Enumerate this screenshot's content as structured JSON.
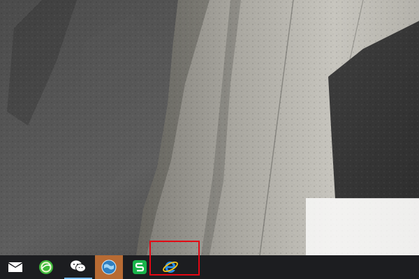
{
  "desktop": {
    "wallpaper": "granite-cliff-photo"
  },
  "taskbar": {
    "background": "#1c1d20",
    "items": [
      {
        "icon": "mail-icon",
        "state": "idle"
      },
      {
        "icon": "360-browser-icon",
        "state": "idle"
      },
      {
        "icon": "wechat-icon",
        "state": "running"
      },
      {
        "icon": "globe-app-icon",
        "state": "active"
      },
      {
        "icon": "wps-spreadsheet-icon",
        "state": "idle"
      },
      {
        "icon": "internet-explorer-icon",
        "state": "idle",
        "highlighted": true
      }
    ]
  },
  "annotation": {
    "highlight_color": "#e30613",
    "target": "internet-explorer-icon"
  }
}
